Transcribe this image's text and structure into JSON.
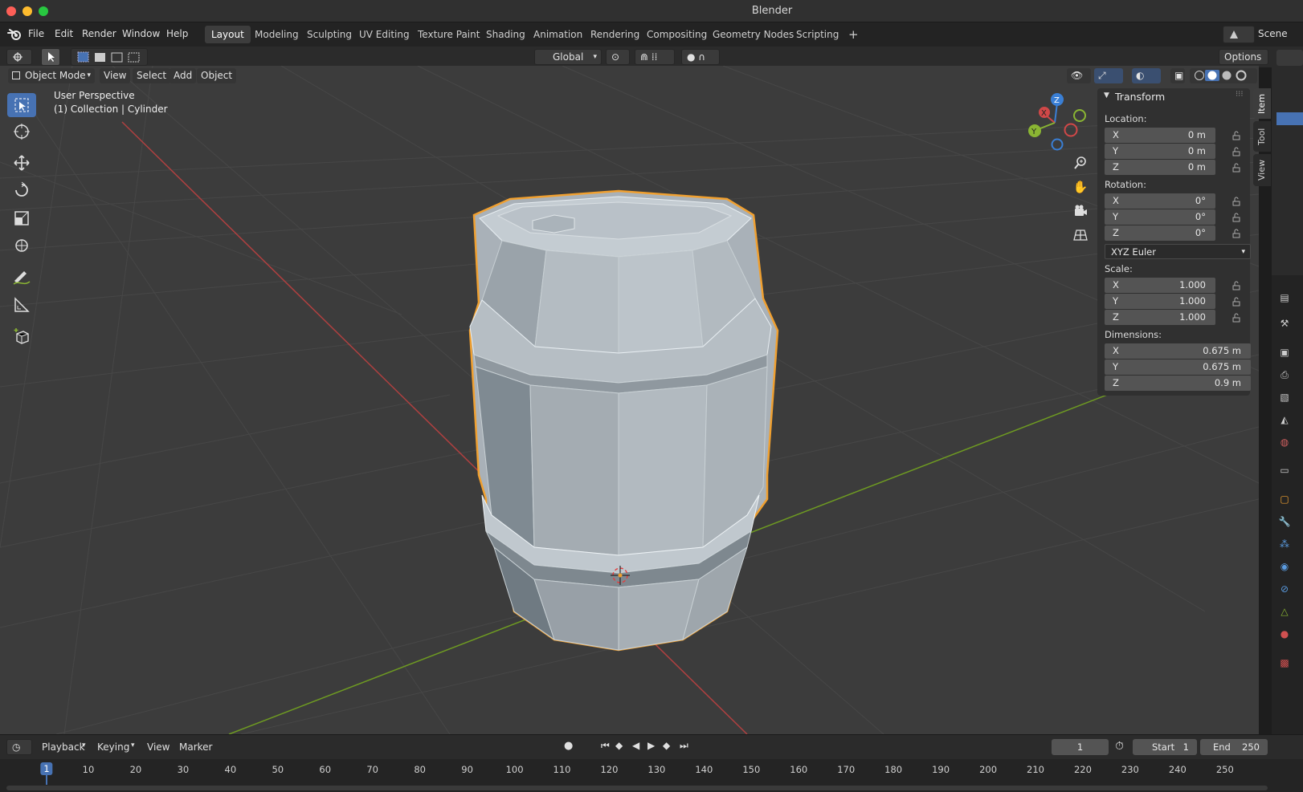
{
  "window": {
    "title": "Blender"
  },
  "menu": [
    "File",
    "Edit",
    "Render",
    "Window",
    "Help"
  ],
  "workspaces": [
    {
      "label": "Layout",
      "active": true
    },
    {
      "label": "Modeling"
    },
    {
      "label": "Sculpting"
    },
    {
      "label": "UV Editing"
    },
    {
      "label": "Texture Paint"
    },
    {
      "label": "Shading"
    },
    {
      "label": "Animation"
    },
    {
      "label": "Rendering"
    },
    {
      "label": "Compositing"
    },
    {
      "label": "Geometry Nodes"
    },
    {
      "label": "Scripting"
    }
  ],
  "scene": {
    "label": "Scene"
  },
  "toolheader": {
    "transform_orientation": "Global",
    "options_label": "Options"
  },
  "viewport_header": {
    "mode": "Object Mode",
    "menus": [
      "View",
      "Select",
      "Add",
      "Object"
    ]
  },
  "overlay": {
    "perspective": "User Perspective",
    "collection": "(1) Collection | Cylinder"
  },
  "gizmo": {
    "z": "Z",
    "x": "X",
    "y": "Y"
  },
  "npanel": {
    "title": "Transform",
    "tabs": [
      "Item",
      "Tool",
      "View"
    ],
    "location_label": "Location:",
    "location": [
      {
        "axis": "X",
        "value": "0 m"
      },
      {
        "axis": "Y",
        "value": "0 m"
      },
      {
        "axis": "Z",
        "value": "0 m"
      }
    ],
    "rotation_label": "Rotation:",
    "rotation": [
      {
        "axis": "X",
        "value": "0°"
      },
      {
        "axis": "Y",
        "value": "0°"
      },
      {
        "axis": "Z",
        "value": "0°"
      }
    ],
    "rotation_mode": "XYZ Euler",
    "scale_label": "Scale:",
    "scale": [
      {
        "axis": "X",
        "value": "1.000"
      },
      {
        "axis": "Y",
        "value": "1.000"
      },
      {
        "axis": "Z",
        "value": "1.000"
      }
    ],
    "dimensions_label": "Dimensions:",
    "dimensions": [
      {
        "axis": "X",
        "value": "0.675 m"
      },
      {
        "axis": "Y",
        "value": "0.675 m"
      },
      {
        "axis": "Z",
        "value": "0.9 m"
      }
    ]
  },
  "timeline": {
    "menus": [
      "Playback",
      "Keying",
      "View",
      "Marker"
    ],
    "current_frame": "1",
    "start_label": "Start",
    "start": "1",
    "end_label": "End",
    "end": "250",
    "ruler": [
      "1",
      "10",
      "20",
      "30",
      "40",
      "50",
      "60",
      "70",
      "80",
      "90",
      "100",
      "110",
      "120",
      "130",
      "140",
      "150",
      "160",
      "170",
      "180",
      "190",
      "200",
      "210",
      "220",
      "230",
      "240",
      "250"
    ]
  },
  "colors": {
    "accent": "#4772b3",
    "selection_outline": "#f0a030",
    "x_axis": "#d04848",
    "y_axis": "#8ab533",
    "z_axis": "#3a7fd5"
  }
}
